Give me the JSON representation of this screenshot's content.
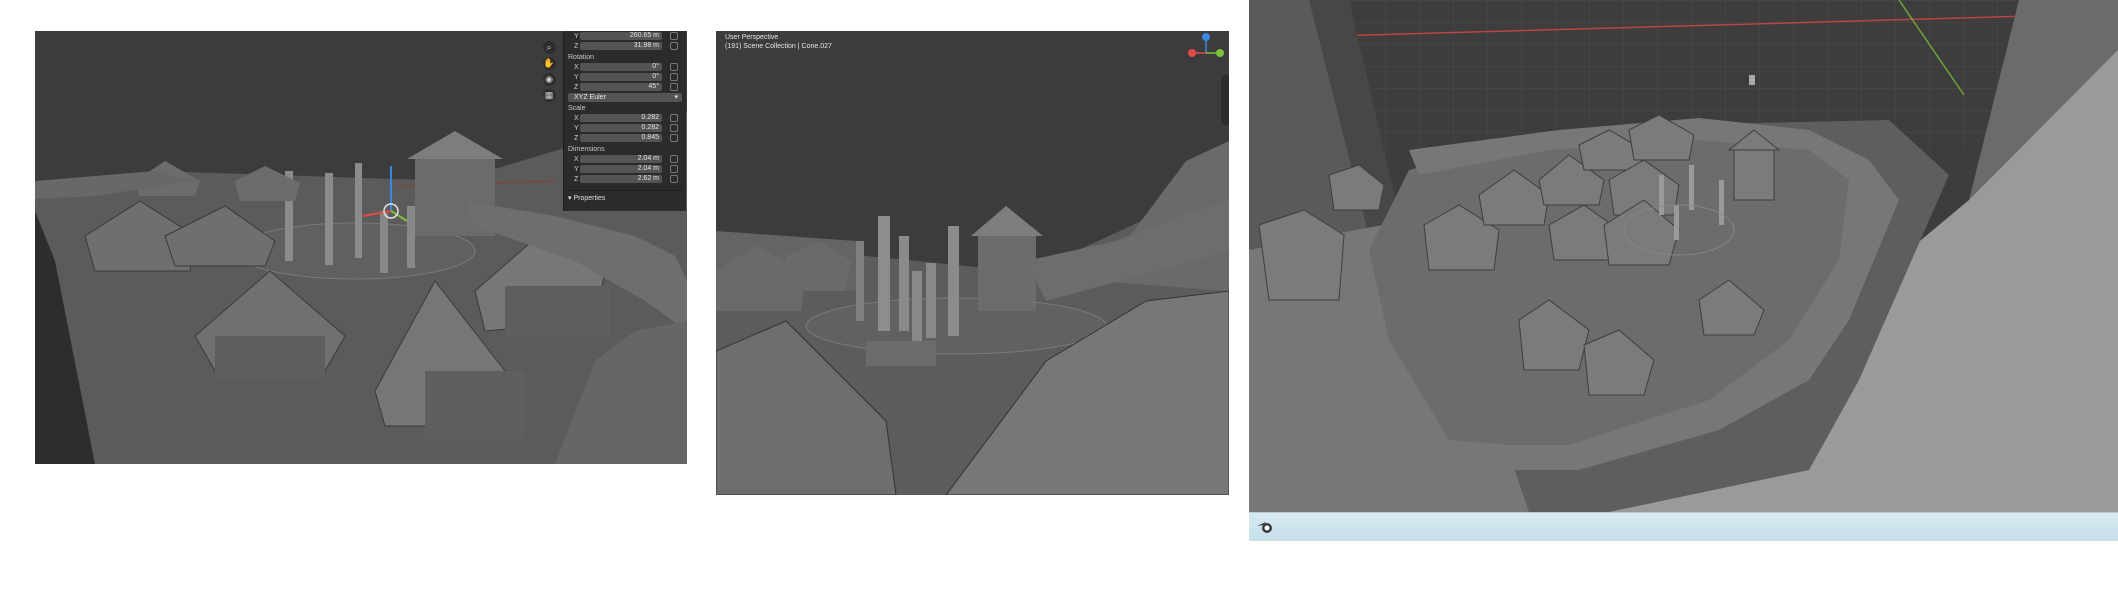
{
  "panel1": {
    "transform": {
      "location_y": "260.65 m",
      "location_z": "31.98 m",
      "rotation_label": "Rotation",
      "rotation": [
        {
          "axis": "X",
          "value": "0°"
        },
        {
          "axis": "Y",
          "value": "0°"
        },
        {
          "axis": "Z",
          "value": "45°"
        }
      ],
      "rotation_mode": "XYZ Euler",
      "scale_label": "Scale",
      "scale": [
        {
          "axis": "X",
          "value": "0.282"
        },
        {
          "axis": "Y",
          "value": "0.282"
        },
        {
          "axis": "Z",
          "value": "0.845"
        }
      ],
      "dimensions_label": "Dimensions",
      "dimensions": [
        {
          "axis": "X",
          "value": "2.04 m"
        },
        {
          "axis": "Y",
          "value": "2.04 m"
        },
        {
          "axis": "Z",
          "value": "2.62 m"
        }
      ],
      "properties_label": "Properties",
      "axis_y": "Y",
      "axis_z": "Z"
    },
    "tools": [
      "zoom-icon",
      "hand-icon",
      "camera-icon",
      "grid-icon"
    ]
  },
  "panel2": {
    "view_name": "User Perspective",
    "collection_path": "(191) Scene Collection | Cone.027",
    "gizmo_axes": {
      "z": "Z",
      "x": "X",
      "y": "Y"
    }
  },
  "colors": {
    "viewport_bg": "#3a3a3a",
    "axis_x": "#e24a4a",
    "axis_y": "#7fc23a",
    "axis_z": "#3d86e0",
    "taskbar": "#cfe5ee"
  }
}
